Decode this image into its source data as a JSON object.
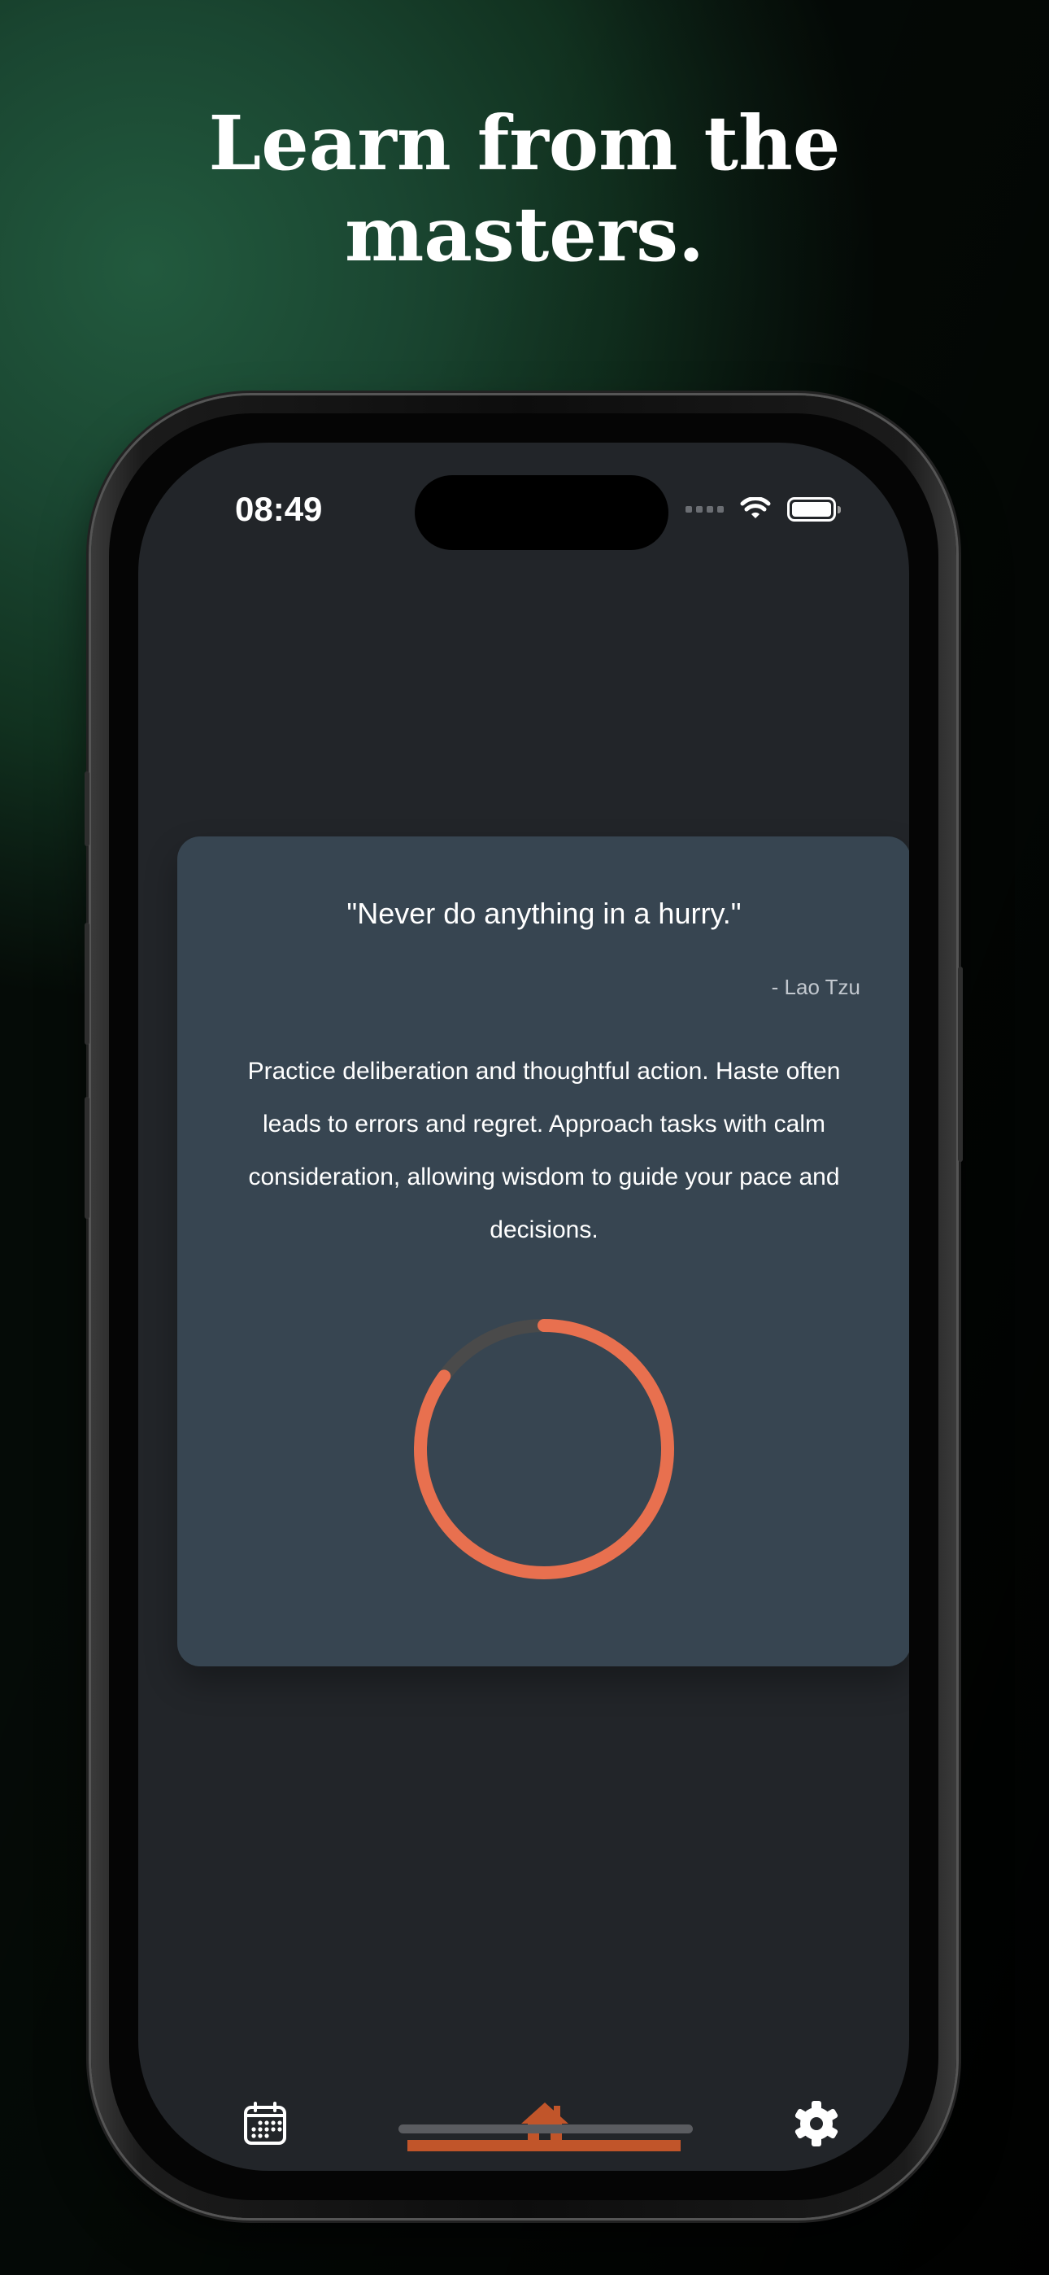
{
  "headline": {
    "line1": "Learn from the",
    "line2": "masters."
  },
  "status_bar": {
    "time": "08:49"
  },
  "quote_card": {
    "quote": "\"Never do anything in a hurry.\"",
    "author": "- Lao Tzu",
    "description": "Practice deliberation and thoughtful action. Haste often leads to errors and regret. Approach tasks with calm consideration, allowing wisdom to guide your pace and decisions.",
    "timer_progress": 0.85
  },
  "tab_bar": {
    "items": [
      {
        "name": "calendar",
        "icon": "calendar-icon",
        "active": false
      },
      {
        "name": "home",
        "icon": "home-icon",
        "active": true
      },
      {
        "name": "settings",
        "icon": "gear-icon",
        "active": false
      }
    ]
  },
  "colors": {
    "accent": "#E8704F",
    "tab_active": "#C1552A",
    "card_bg": "#374551",
    "screen_bg": "#222529",
    "timer_track": "#4A4A4A"
  }
}
